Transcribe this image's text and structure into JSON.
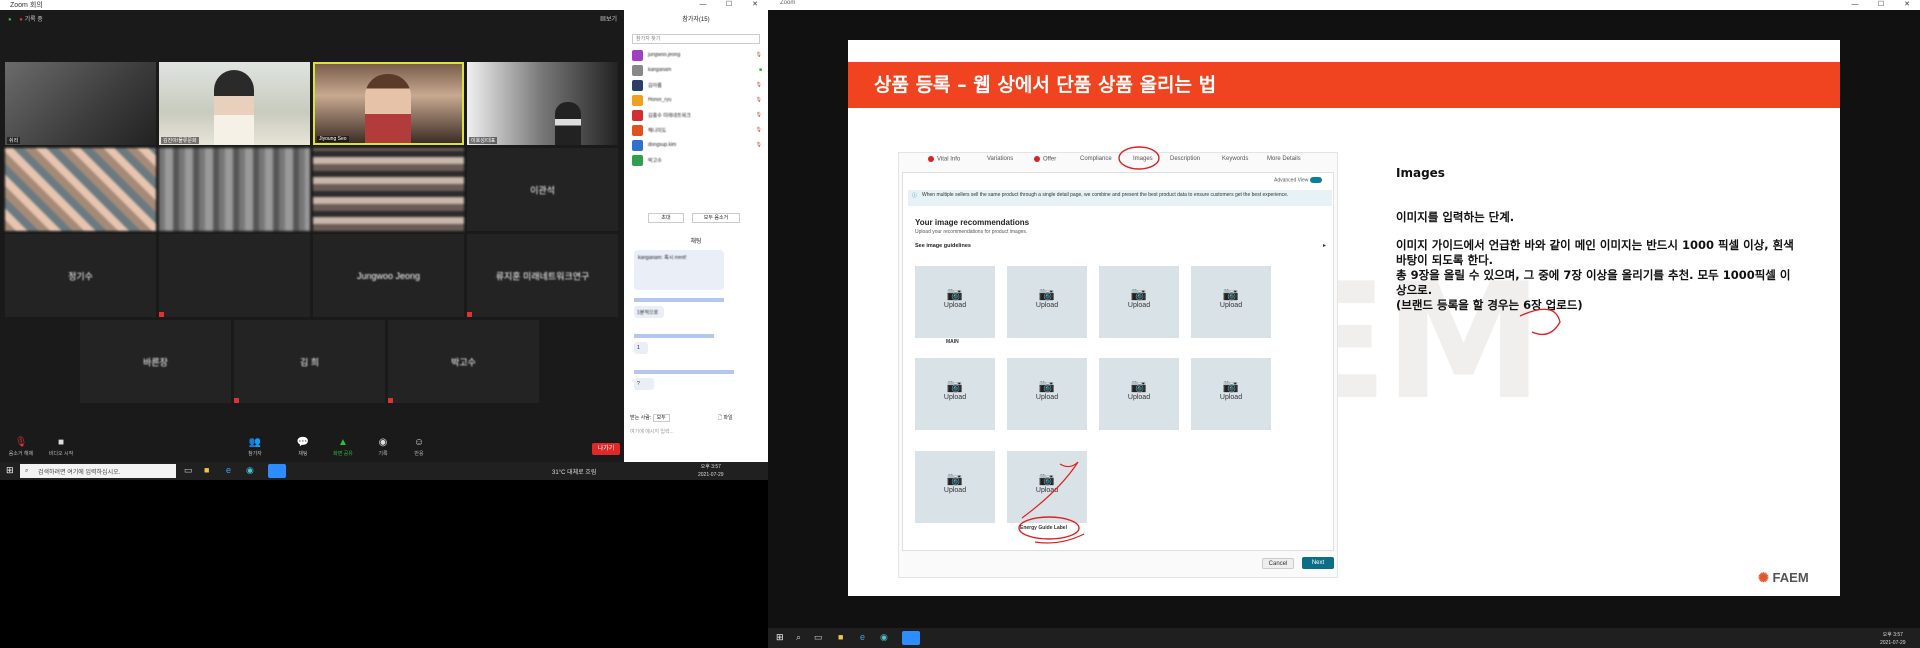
{
  "left_window": {
    "title": "Zoom 회의",
    "rec_label": "기록 중",
    "view_label": "보기",
    "tiles": [
      {
        "name": "쉬리",
        "kind": "video"
      },
      {
        "name": "김진아/물류문화",
        "kind": "video"
      },
      {
        "name": "Jiyoung Seo",
        "kind": "video"
      },
      {
        "name": "이호성/대표",
        "kind": "video"
      },
      {
        "name": "",
        "kind": "video"
      },
      {
        "name": "",
        "kind": "video"
      },
      {
        "name": "",
        "kind": "video"
      },
      {
        "name": "이관석",
        "kind": "name"
      },
      {
        "name": "",
        "kind": "name"
      },
      {
        "name": "정기수",
        "kind": "name"
      },
      {
        "name": "Jungwoo Jeong",
        "kind": "name"
      },
      {
        "name": "류지훈 미래네트워크연구",
        "kind": "name"
      },
      {
        "name": "바른장",
        "kind": "name"
      },
      {
        "name": "김 희",
        "kind": "name"
      },
      {
        "name": "박고수",
        "kind": "name"
      }
    ],
    "toolbar": {
      "audio": "음소거 해제",
      "video": "비디오 시작",
      "participants": "참가자",
      "participants_count": "15",
      "chat": "채팅",
      "share": "화면 공유",
      "record": "기록",
      "reactions": "반응",
      "leave": "나가기"
    },
    "panel": {
      "header": "참가자(15)",
      "search": "참가자 찾기",
      "participants": [
        "jungwoo.jeong",
        "kanganam",
        "김아름",
        "Honor_ryu",
        "김흥수 미래네트워크",
        "혜나미도",
        "dongsup.kim",
        "박고수"
      ],
      "invite": "초대",
      "mute_all": "모두 음소거",
      "chat_header": "채팅",
      "messages": [
        "kanganam: 혹시 ",
        "rrent!",
        "1분적으로",
        "1",
        "?"
      ],
      "to_label": "받는 사람:",
      "to_value": "모두",
      "file_label": "파일",
      "chat_placeholder": "여기에 메시지 입력..."
    },
    "taskbar": {
      "search": "검색하려면 여기에 입력하십시오.",
      "weather": "31°C 대체로 흐림",
      "time": "오후 3:57",
      "date": "2021-07-29"
    }
  },
  "right_window": {
    "title": "Zoom",
    "slide": {
      "title": "상품 등록 – 웹 상에서 단품 상품 올리는 법",
      "tabs": [
        {
          "label": "Vital Info",
          "alert": true
        },
        {
          "label": "Variations",
          "alert": false
        },
        {
          "label": "Offer",
          "alert": true
        },
        {
          "label": "Compliance",
          "alert": false
        },
        {
          "label": "Images",
          "alert": false
        },
        {
          "label": "Description",
          "alert": false
        },
        {
          "label": "Keywords",
          "alert": false
        },
        {
          "label": "More Details",
          "alert": false
        }
      ],
      "advanced_view": "Advanced View",
      "notice": "When multiple sellers sell the same product through a single detail page, we combine and present the best product data to ensure customers get the best experience.",
      "section_title": "Your image recommendations",
      "section_sub": "Upload your recommendations for product images.",
      "guidelines": "See image guidelines",
      "upload_label": "Upload",
      "main_label": "MAIN",
      "energy_label": "Energy Guide Label",
      "cancel": "Cancel",
      "next": "Next",
      "right_heading": "Images",
      "right_lines": [
        "이미지를 입력하는 단계.",
        "이미지 가이드에서 언급한 바와 같이 메인 이미지는 반드시 1000 픽셀 이상, 흰색 바탕이 되도록 한다.",
        "총 9장을 올릴 수 있으며, 그 중에 7장 이상을 올리기를 추천.  모두 1000픽셀 이상으로.",
        "(브랜드 등록을 할 경우는 6장 업로드)"
      ],
      "watermark": "FAEM",
      "logo": "FAEM"
    },
    "taskbar": {
      "time": "오후 3:57",
      "date": "2021-07-29"
    }
  }
}
